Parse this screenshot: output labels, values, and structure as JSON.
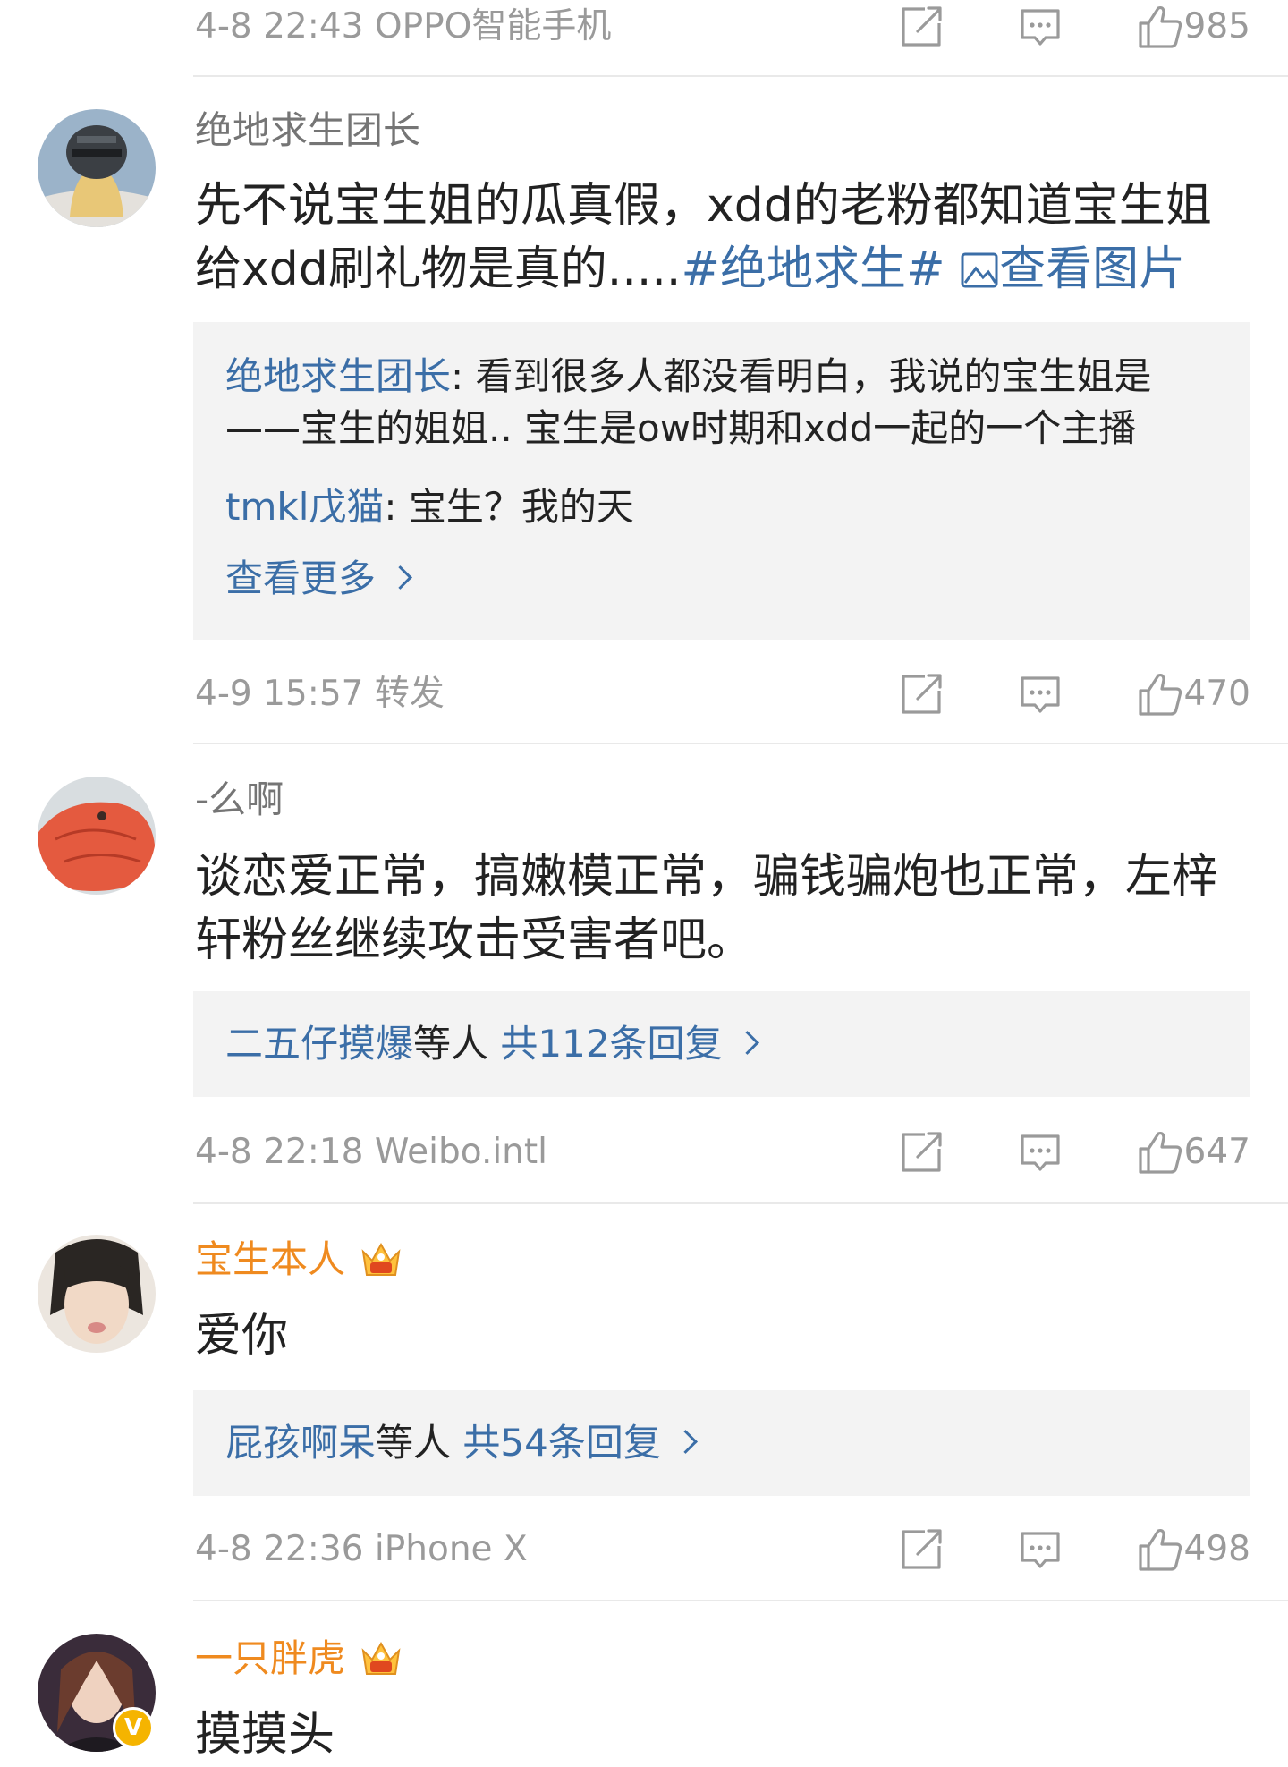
{
  "comments": [
    {
      "meta": {
        "time": "4-8 22:43",
        "source": "OPPO智能手机",
        "likes": "985"
      }
    },
    {
      "user": "绝地求生团长",
      "text_plain": "先不说宝生姐的瓜真假，xdd的老粉都知道宝生姐给xdd刷礼物是真的.....",
      "hashtag": "#绝地求生#",
      "view_image": "查看图片",
      "replies": [
        {
          "who": "绝地求生团长",
          "text": ": 看到很多人都没看明白，我说的宝生姐是——宝生的姐姐.. 宝生是ow时期和xdd一起的一个主播"
        },
        {
          "who": "tmkl戊猫",
          "text": ": 宝生？我的天"
        }
      ],
      "more": "查看更多",
      "meta": {
        "time": "4-9 15:57",
        "source": "转发",
        "likes": "470"
      }
    },
    {
      "user": "-么啊",
      "text": "谈恋爱正常，搞嫩模正常，骗钱骗炮也正常，左梓轩粉丝继续攻击受害者吧。",
      "reply_names": "二五仔摸爆",
      "reply_mid": "等人",
      "reply_count": "共112条回复",
      "meta": {
        "time": "4-8 22:18",
        "source": "Weibo.intl",
        "likes": "647"
      }
    },
    {
      "user": "宝生本人",
      "text": "爱你",
      "reply_names": "屁孩啊呆",
      "reply_mid": "等人",
      "reply_count": "共54条回复",
      "meta": {
        "time": "4-8 22:36",
        "source": "iPhone X",
        "likes": "498"
      }
    },
    {
      "user": "一只胖虎",
      "text": "摸摸头"
    }
  ],
  "icons": {
    "repost": "repost-icon",
    "comment": "comment-icon",
    "like": "like-icon",
    "crown": "vip-crown-icon",
    "verified": "verified-badge-icon"
  },
  "badge_letter": "V",
  "colors": {
    "link": "#3b6ea7",
    "vip_name": "#ef8a1f",
    "meta": "#9a9a9a",
    "reply_bg": "#f3f3f3",
    "divider": "#e9e9e9"
  }
}
